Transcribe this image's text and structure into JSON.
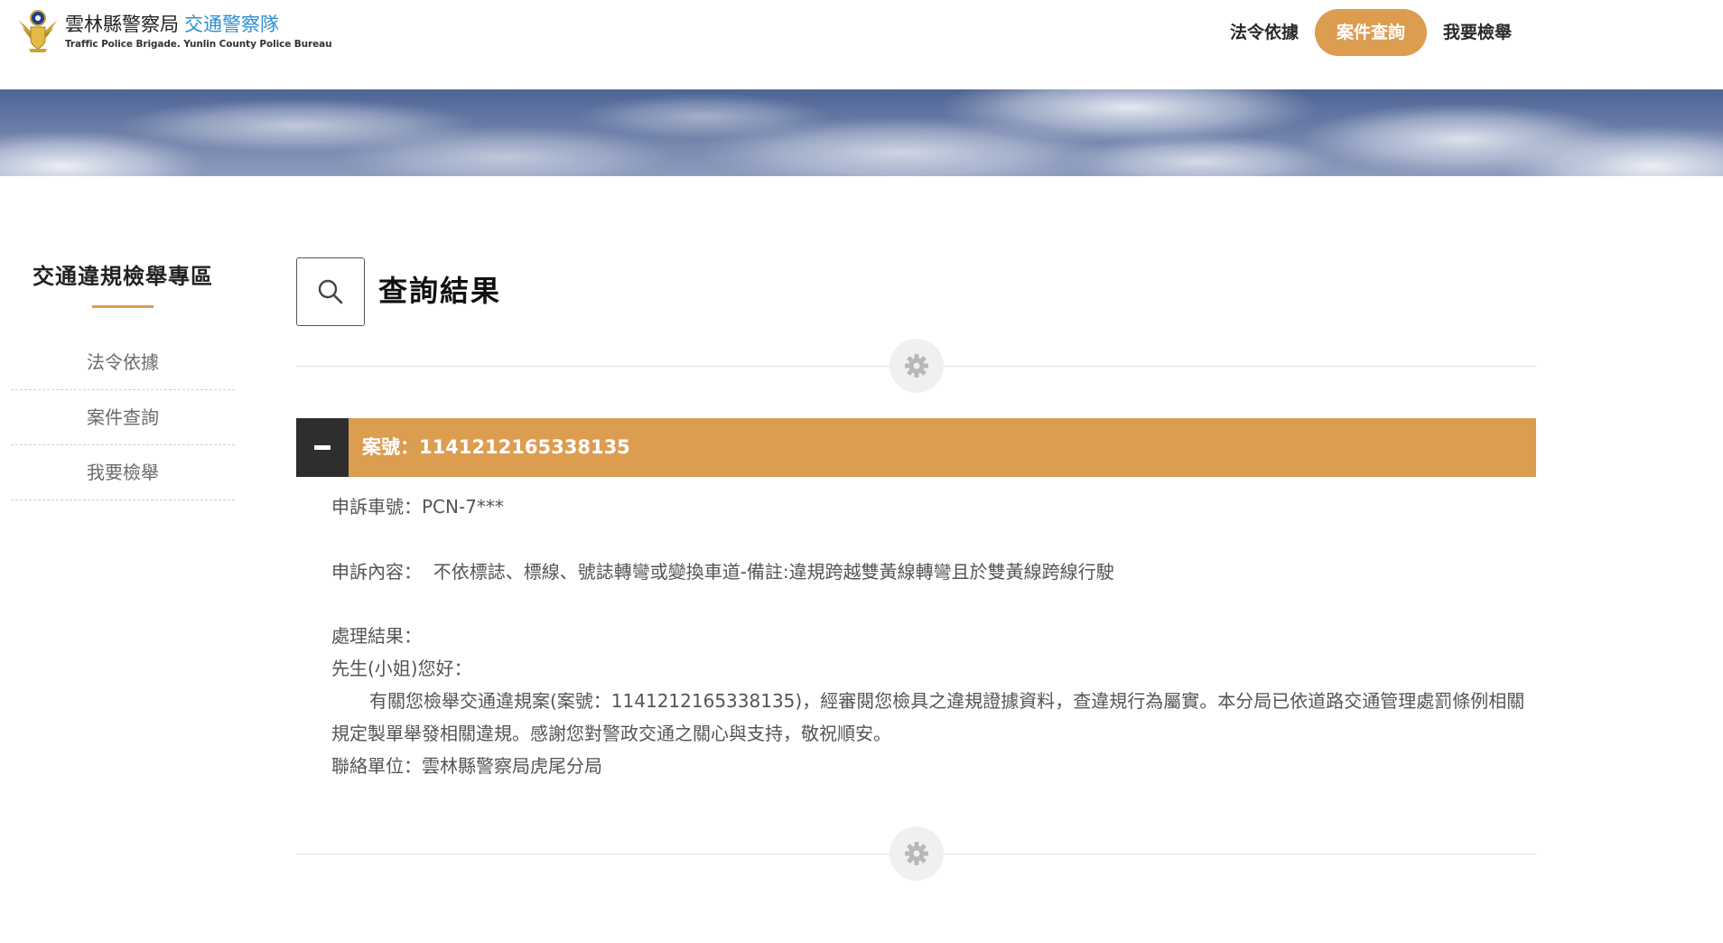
{
  "header": {
    "logo_title": "雲林縣警察局",
    "logo_title_accent": "交通警察隊",
    "logo_subtitle": "Traffic Police Brigade. Yunlin County Police Bureau",
    "logo_icon": "police-emblem-icon",
    "nav": [
      {
        "label": "法令依據"
      },
      {
        "label": "案件查詢"
      },
      {
        "label": "我要檢舉"
      }
    ],
    "active_nav": "案件查詢"
  },
  "sidebar": {
    "title": "交通違規檢舉專區",
    "items": [
      {
        "label": "法令依據"
      },
      {
        "label": "案件查詢"
      },
      {
        "label": "我要檢舉"
      }
    ]
  },
  "main": {
    "search_icon": "search-icon",
    "title": "查詢結果",
    "case": {
      "label": "案號：1141212165338135",
      "collapse_icon": "minus-icon",
      "plate_line": "申訴車號：PCN-7***",
      "content_line": "申訴內容：  不依標誌、標線、號誌轉彎或變換車道-備註:違規跨越雙黃線轉彎且於雙黃線跨線行駛",
      "result_label": "處理結果：",
      "greeting": "先生(小姐)您好：",
      "result_body": "有關您檢舉交通違規案(案號：1141212165338135)，經審閱您檢具之違規證據資料，查違規行為屬實。本分局已依道路交通管理處罰條例相關規定製單舉發相關違規。感謝您對警政交通之關心與支持，敬祝順安。",
      "contact": "聯絡單位：雲林縣警察局虎尾分局"
    },
    "divider_icon": "gear-icon"
  },
  "colors": {
    "accent": "#dc9d51",
    "dark": "#2e2e2e",
    "logo_accent": "#2f8fd0"
  }
}
